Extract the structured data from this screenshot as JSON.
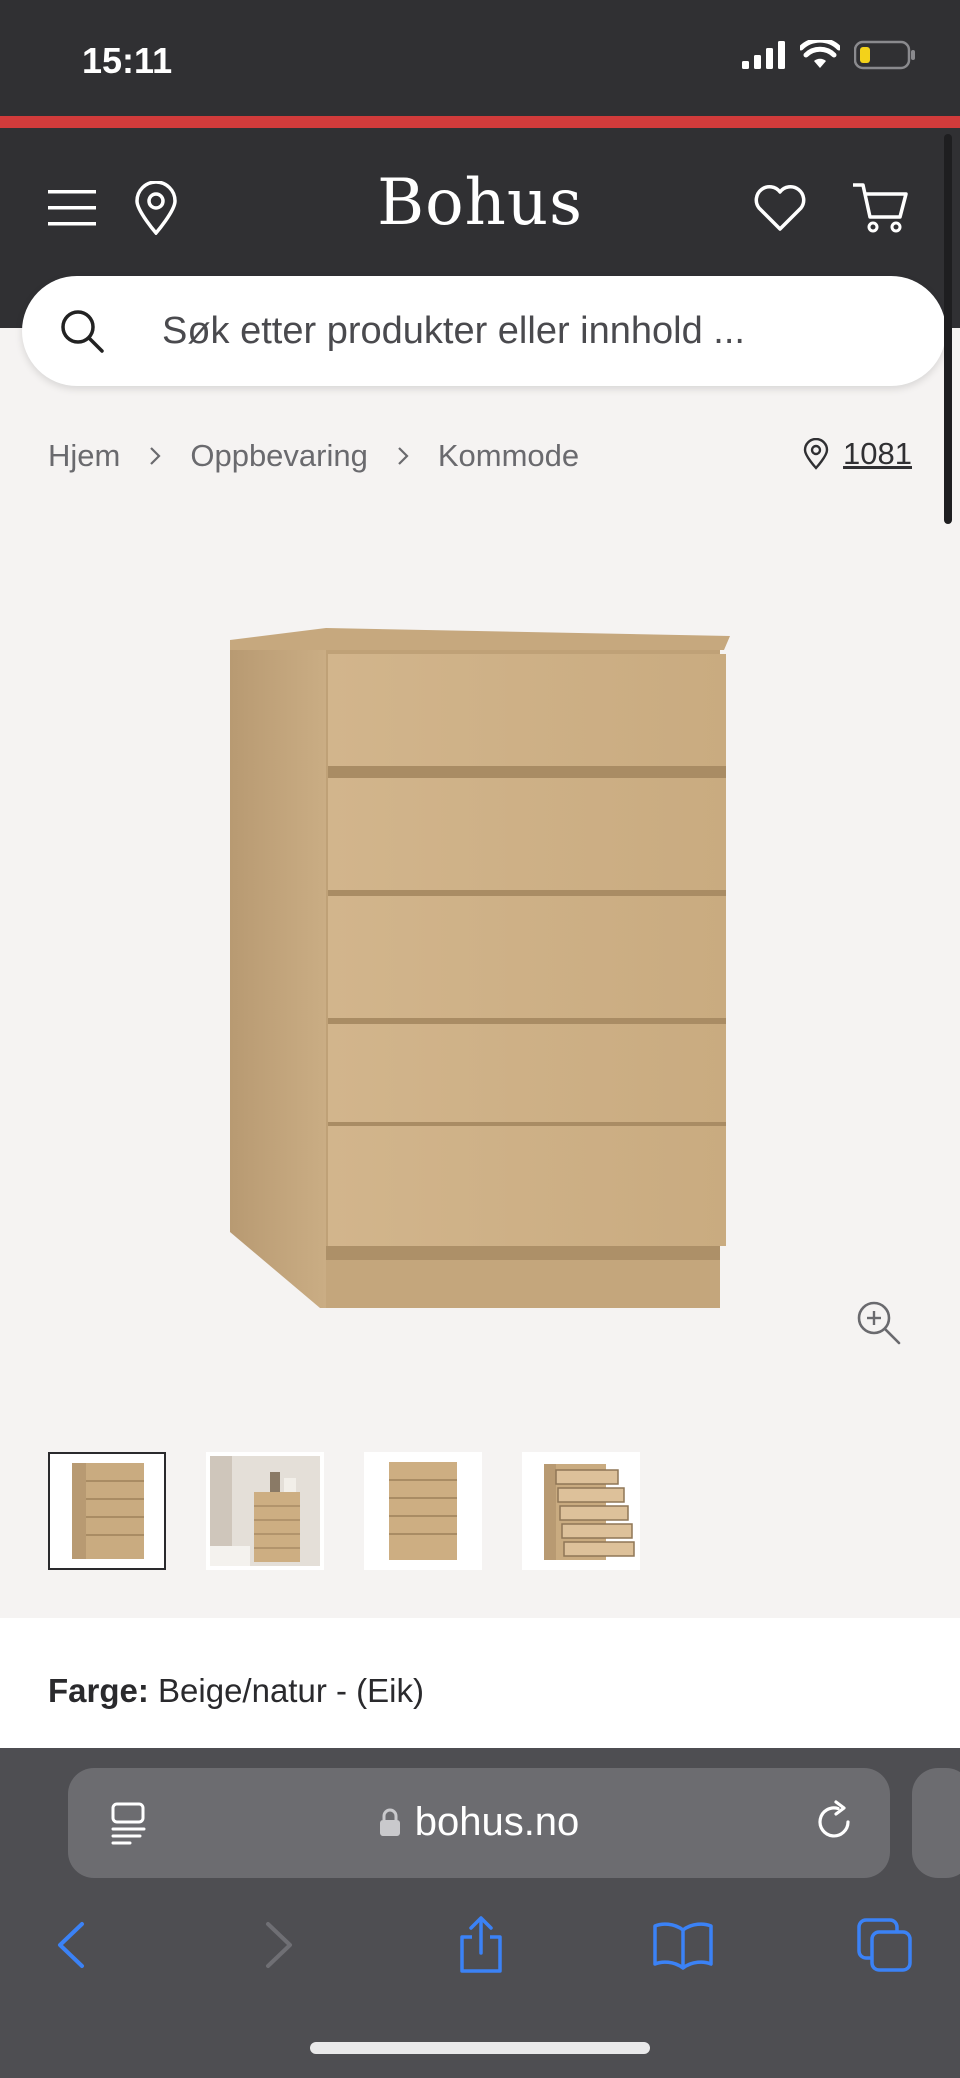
{
  "status_bar": {
    "time": "15:11",
    "battery_level": 0.2
  },
  "header": {
    "logo": "Bohus",
    "accent_color": "#d23b3b",
    "background_color": "#303033"
  },
  "search": {
    "placeholder": "Søk etter produkter eller innhold ..."
  },
  "breadcrumb": {
    "items": [
      "Hjem",
      "Oppbevaring",
      "Kommode"
    ],
    "store_number": "1081"
  },
  "product": {
    "color_label": "Farge:",
    "color_value": "Beige/natur - (Eik)",
    "thumbnail_count": 4,
    "active_thumbnail": 0
  },
  "browser": {
    "url": "bohus.no"
  }
}
